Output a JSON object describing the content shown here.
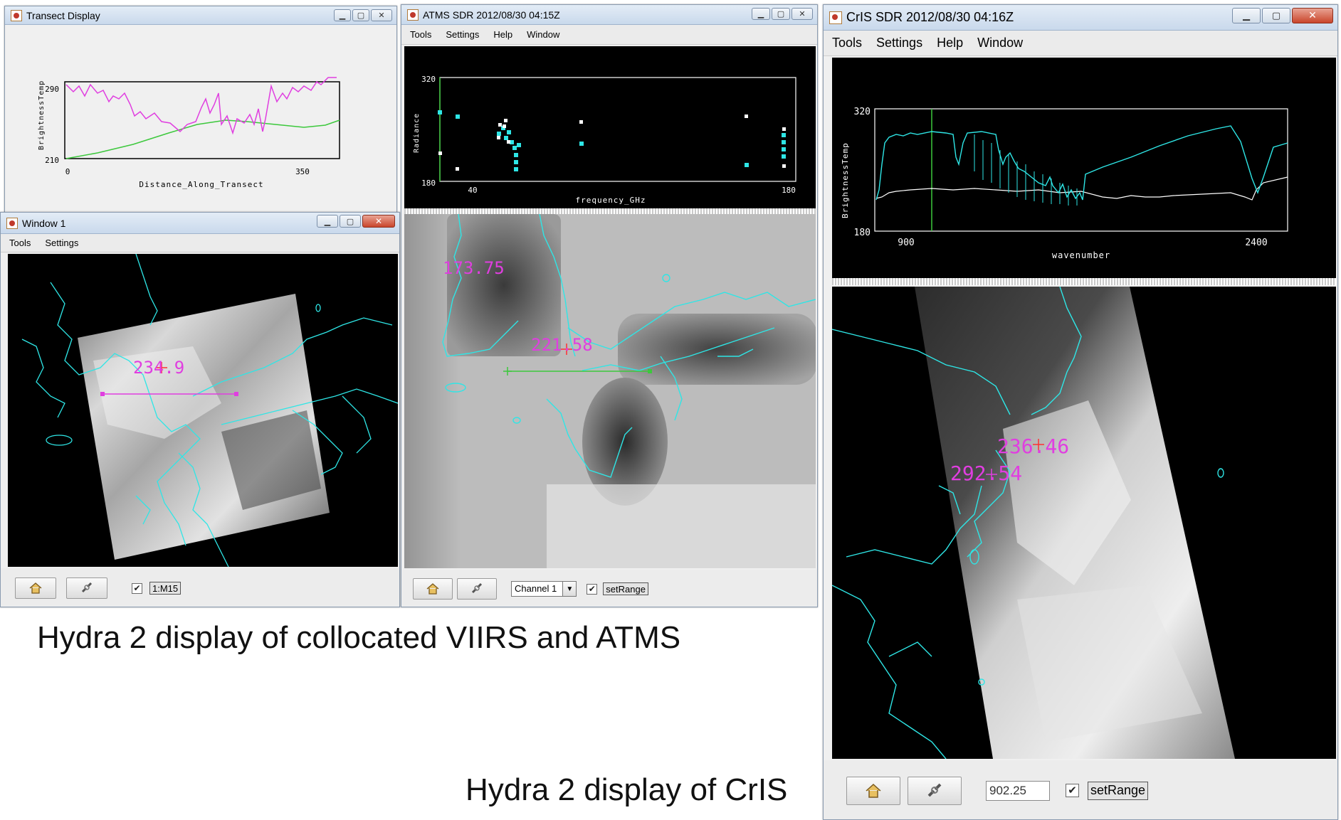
{
  "transect_window": {
    "title": "Transect Display",
    "plot": {
      "ylabel": "BrightnessTemp",
      "xlabel": "Distance_Along_Transect",
      "y_top": "290",
      "y_bottom": "210",
      "x_left": "0",
      "x_right": "350"
    }
  },
  "window1": {
    "title": "Window 1",
    "menu": [
      "Tools",
      "Settings"
    ],
    "probe_value": "234.9",
    "toolbar": {
      "check_mark": "✔",
      "band_label": "1:M15"
    }
  },
  "atms_window": {
    "title": "ATMS SDR 2012/08/30  04:15Z",
    "menu": [
      "Tools",
      "Settings",
      "Help",
      "Window"
    ],
    "plot": {
      "ylabel": "Radiance",
      "xlabel": "frequency_GHz",
      "y_top": "320",
      "y_bottom": "180",
      "x_left": "40",
      "x_right": "180"
    },
    "probe_values": [
      "173.75",
      "221.58"
    ],
    "toolbar": {
      "channel_value": "Channel 1",
      "check_mark": "✔",
      "setrange_label": "setRange"
    }
  },
  "cris_window": {
    "title": "CrIS SDR 2012/08/30  04:16Z",
    "menu": [
      "Tools",
      "Settings",
      "Help",
      "Window"
    ],
    "plot": {
      "ylabel": "BrightnessTemp",
      "xlabel": "wavenumber",
      "y_top": "320",
      "y_bottom": "180",
      "x_left": "900",
      "x_right": "2400"
    },
    "probe_values": [
      "236.46",
      "292.54"
    ],
    "toolbar": {
      "wavenumber_value": "902.25",
      "check_mark": "✔",
      "setrange_label": "setRange"
    }
  },
  "captions": {
    "viirs_atms": "Hydra 2 display of collocated VIIRS and ATMS",
    "cris": "Hydra 2 display of CrIS"
  },
  "colors": {
    "cyan": "#2ee6e6",
    "magenta": "#e03ee0",
    "green": "#3cc83c",
    "probe_red": "#ff3030"
  },
  "icons": [
    "java-app-icon",
    "minimize-icon",
    "maximize-icon",
    "close-icon",
    "home-icon",
    "link-icon",
    "dropdown-arrow-icon",
    "checkbox-icon"
  ]
}
